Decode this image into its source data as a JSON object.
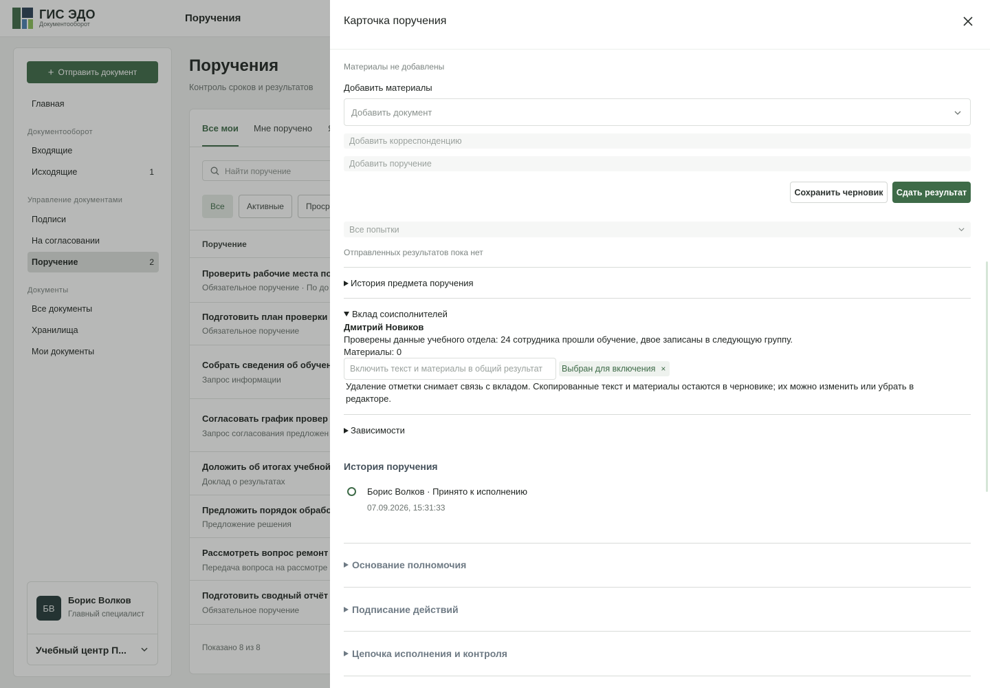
{
  "app": {
    "logo_title": "ГИС ЭДО",
    "logo_subtitle": "Документооборот",
    "top_page_title": "Поручения",
    "brand_color": "#3e6b48"
  },
  "sidebar": {
    "send_button": "Отправить документ",
    "home": "Главная",
    "sections": [
      {
        "title": "Документооборот",
        "items": [
          {
            "label": "Входящие",
            "count": ""
          },
          {
            "label": "Исходящие",
            "count": "1"
          }
        ]
      },
      {
        "title": "Управление документами",
        "items": [
          {
            "label": "Подписи",
            "count": ""
          },
          {
            "label": "На согласовании",
            "count": ""
          },
          {
            "label": "Поручение",
            "count": "2",
            "active": true
          }
        ]
      },
      {
        "title": "Документы",
        "items": [
          {
            "label": "Все документы",
            "count": ""
          },
          {
            "label": "Хранилища",
            "count": ""
          },
          {
            "label": "Мои документы",
            "count": ""
          }
        ]
      }
    ],
    "user": {
      "initials": "БВ",
      "name": "Борис Волков",
      "role": "Главный специалист",
      "org": "Учебный центр П..."
    }
  },
  "main": {
    "title": "Поручения",
    "subtitle": "Контроль сроков и результатов",
    "tabs": [
      "Все мои",
      "Мне поручено",
      "Я"
    ],
    "search_placeholder": "Найти поручение",
    "filters": [
      "Все",
      "Активные",
      "Проср"
    ],
    "column_header": "Поручение",
    "rows": [
      {
        "title": "Проверить рабочие места по",
        "sub": "Обязательное поручение · По до"
      },
      {
        "title": "Подготовить план проверки",
        "sub": "Обязательное поручение"
      },
      {
        "title": "Собрать сведения об обучен",
        "sub": "Запрос информации"
      },
      {
        "title": "Согласовать график провер",
        "sub": "Запрос согласования предложен"
      },
      {
        "title": "Доложить об итогах учебной",
        "sub": "Доклад о результатах"
      },
      {
        "title": "Предложить порядок обрабо",
        "sub": "Предложение решения"
      },
      {
        "title": "Рассмотреть вопрос ремонт",
        "sub": "Передача вопроса на рассмотре"
      },
      {
        "title": "Подготовить сводный отчёт",
        "sub": "Обязательное поручение"
      }
    ],
    "pager": "Показано 8 из 8"
  },
  "drawer": {
    "title": "Карточка поручения",
    "materials_empty": "Материалы не добавлены",
    "add_materials_label": "Добавить материалы",
    "add_document_placeholder": "Добавить документ",
    "add_correspondence": "Добавить корреспонденцию",
    "add_assignment": "Добавить поручение",
    "save_draft": "Сохранить черновик",
    "submit_result": "Сдать результат",
    "attempts_placeholder": "Все попытки",
    "no_results": "Отправленных результатов пока нет",
    "subject_history": "История предмета поручения",
    "coexec": {
      "title": "Вклад соисполнителей",
      "name": "Дмитрий Новиков",
      "text": "Проверены данные учебного отдела: 24 сотрудника прошли обучение, двое записаны в следующую группу.",
      "materials": "Материалы: 0",
      "include_placeholder": "Включить текст и материалы в общий результат",
      "chip": "Выбран для включения",
      "chip_remove": "×",
      "note": "Удаление отметки снимает связь с вкладом. Скопированные текст и материалы остаются в черновике; их можно изменить или убрать в редакторе."
    },
    "dependencies": "Зависимости",
    "history": {
      "title": "История поручения",
      "entry": "Борис Волков · Принято к исполнению",
      "time": "07.09.2026, 15:31:33"
    },
    "sections": [
      "Основание полномочия",
      "Подписание действий",
      "Цепочка исполнения и контроля"
    ]
  }
}
